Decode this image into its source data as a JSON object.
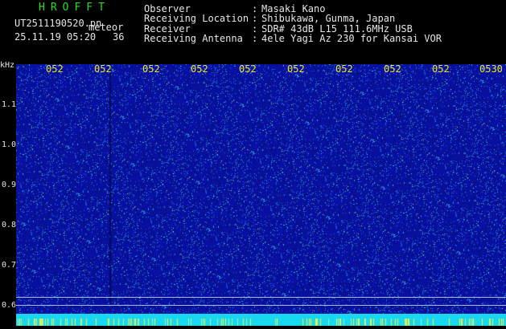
{
  "header": {
    "logo": "HROFFT",
    "filename": "UT2511190520.pn",
    "mode_label": "meteor",
    "timestamp": "25.11.19 05:20",
    "count": "36",
    "fields": [
      {
        "key": "Observer",
        "value": "Masaki Kano"
      },
      {
        "key": "Receiving Location",
        "value": "Shibukawa, Gunma, Japan"
      },
      {
        "key": "Receiver",
        "value": "SDR# 43dB L15 111.6MHz USB"
      },
      {
        "key": "Receiving Antenna",
        "value": "4ele Yagi Az 230 for Kansai VOR"
      }
    ]
  },
  "spectrogram": {
    "y_unit": "kHz",
    "y_ticks": [
      "1.1",
      "1.0",
      "0.9",
      "0.8",
      "0.7",
      "0.6"
    ],
    "x_ticks": [
      "052",
      "052",
      "052",
      "052",
      "052",
      "052",
      "052",
      "052",
      "052",
      "0530"
    ],
    "colors": {
      "background": "#0a14b4",
      "tick_label": "#f0e81e",
      "text": "#e6e6e6",
      "logo": "#22e022",
      "bottom_strip": "#18d8f0"
    }
  }
}
